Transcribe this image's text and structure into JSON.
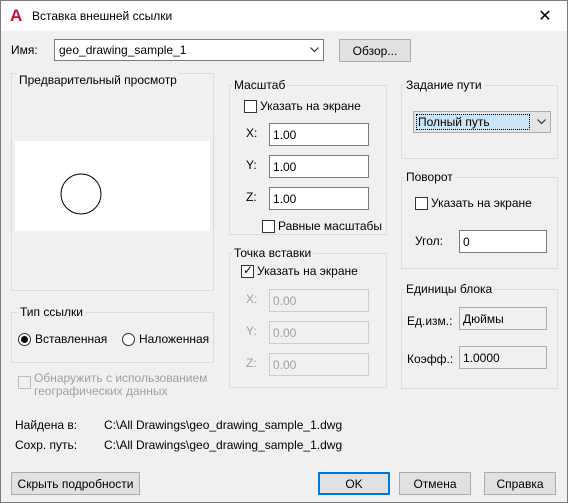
{
  "window": {
    "title": "Вставка внешней ссылки",
    "close_glyph": "✕"
  },
  "name_row": {
    "label": "Имя:",
    "value": "geo_drawing_sample_1",
    "browse_label": "Обзор..."
  },
  "preview": {
    "title": "Предварительный просмотр"
  },
  "scale": {
    "title": "Масштаб",
    "specify_on_screen": "Указать на экране",
    "specify_checked": false,
    "x_label": "X:",
    "x_value": "1.00",
    "y_label": "Y:",
    "y_value": "1.00",
    "z_label": "Z:",
    "z_value": "1.00",
    "uniform_label": "Равные масштабы",
    "uniform_checked": false
  },
  "path": {
    "title": "Задание пути",
    "selected": "Полный путь"
  },
  "rotation": {
    "title": "Поворот",
    "specify_on_screen": "Указать на экране",
    "angle_label": "Угол:",
    "angle_value": "0"
  },
  "insertion": {
    "title": "Точка вставки",
    "specify_on_screen": "Указать на экране",
    "specify_checked": true,
    "x_label": "X:",
    "x_value": "0.00",
    "y_label": "Y:",
    "y_value": "0.00",
    "z_label": "Z:",
    "z_value": "0.00"
  },
  "reference_type": {
    "title": "Тип ссылки",
    "attached": "Вставленная",
    "overlay": "Наложенная",
    "selected": "attached"
  },
  "geo": {
    "label_line1": "Обнаружить с использованием",
    "label_line2": "географических данных"
  },
  "block_units": {
    "title": "Единицы блока",
    "unit_label": "Ед.изм.:",
    "unit_value": "Дюймы",
    "factor_label": "Коэфф.:",
    "factor_value": "1.0000"
  },
  "found_in": {
    "label": "Найдена в:",
    "value": "C:\\All Drawings\\geo_drawing_sample_1.dwg"
  },
  "saved_path": {
    "label": "Сохр. путь:",
    "value": "C:\\All Drawings\\geo_drawing_sample_1.dwg"
  },
  "buttons": {
    "hide_details": "Скрыть подробности",
    "ok": "OK",
    "cancel": "Отмена",
    "help": "Справка"
  },
  "colors": {
    "app_icon": "#c8102e",
    "default_button_border": "#0078d7"
  }
}
